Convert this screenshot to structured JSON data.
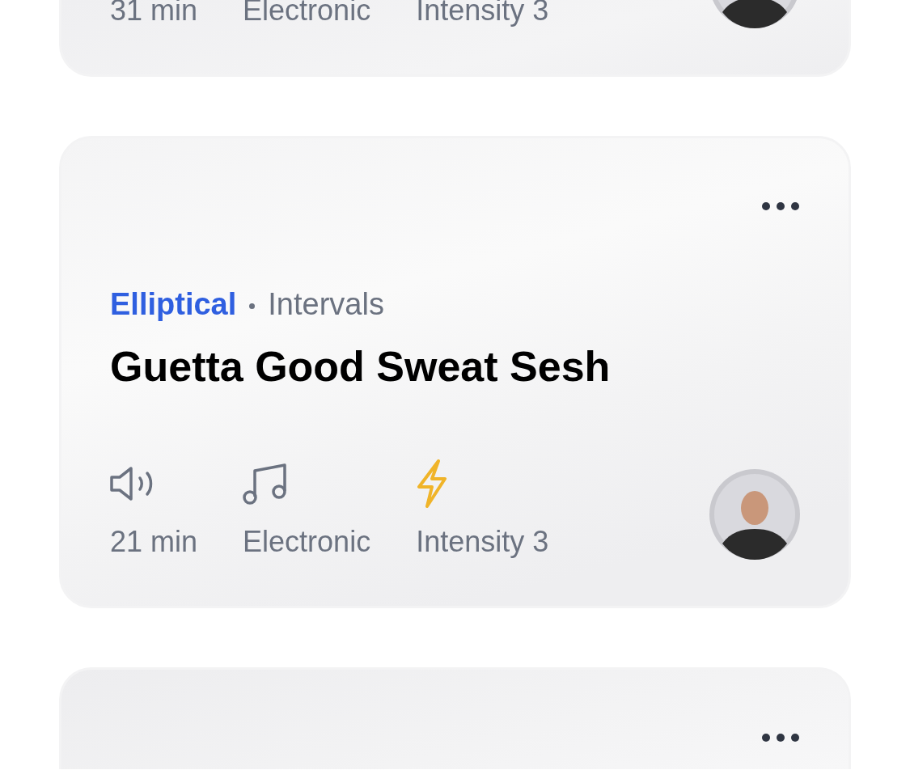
{
  "cards": [
    {
      "kind": "bottom_visible",
      "stats": [
        "31 min",
        "Electronic",
        "Intensity 3"
      ]
    },
    {
      "kind": "full",
      "category": "Elliptical",
      "type": "Intervals",
      "title": "Guetta Good Sweat Sesh",
      "stats": [
        "21 min",
        "Electronic",
        "Intensity 3"
      ]
    },
    {
      "kind": "top_visible"
    }
  ]
}
